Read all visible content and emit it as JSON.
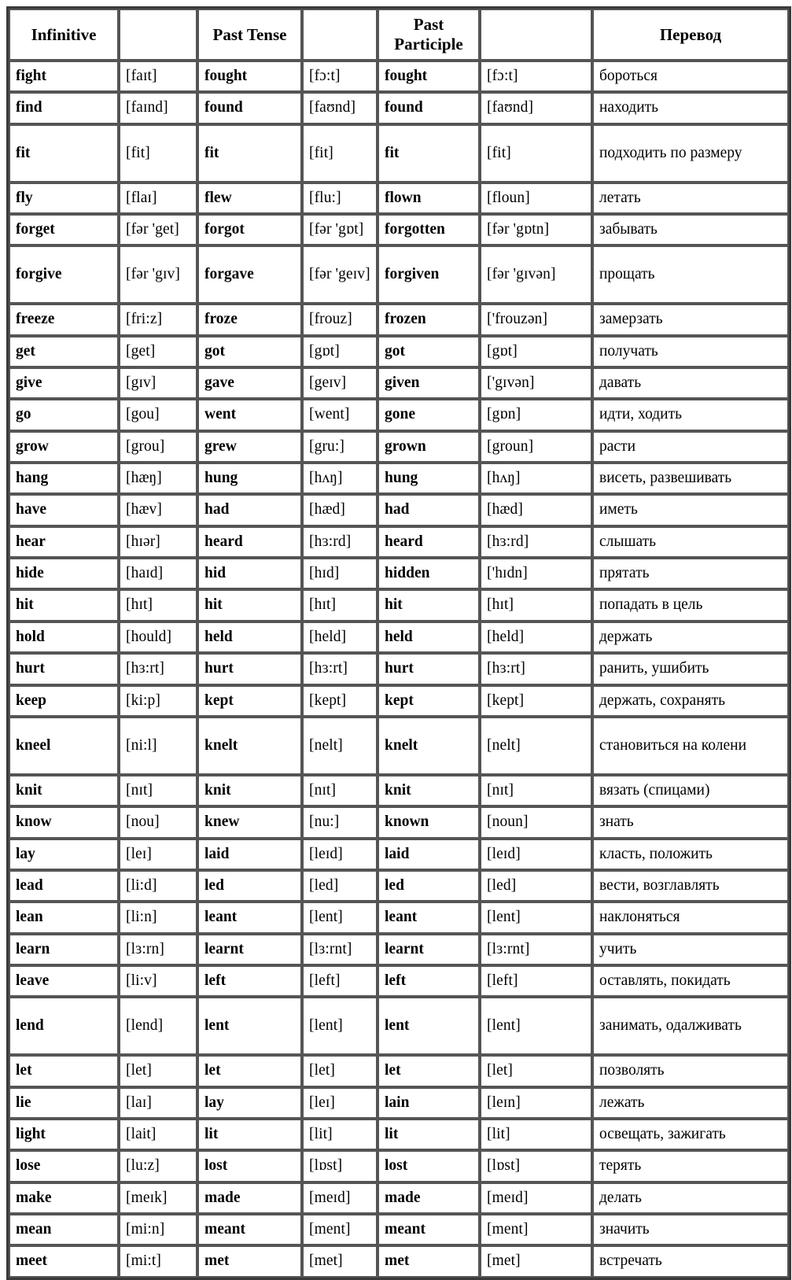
{
  "table": {
    "headers": {
      "infinitive": "Infinitive",
      "infinitive_ipa": "",
      "past_tense": "Past Tense",
      "past_tense_ipa": "",
      "past_participle": "Past\nParticiple",
      "past_participle_line1": "Past",
      "past_participle_line2": "Participle",
      "past_participle_ipa": "",
      "translation": "Перевод"
    },
    "rows": [
      {
        "infinitive": "fight",
        "inf_ipa": "[faɪt]",
        "past": "fought",
        "past_ipa": "[fɔ:t]",
        "pp": "fought",
        "pp_ipa": "[fɔ:t]",
        "ru": "бороться",
        "tall": false
      },
      {
        "infinitive": "find",
        "inf_ipa": "[faɪnd]",
        "past": "found",
        "past_ipa": "[faʊnd]",
        "pp": "found",
        "pp_ipa": "[faʊnd]",
        "ru": "находить",
        "tall": false
      },
      {
        "infinitive": "fit",
        "inf_ipa": "[fit]",
        "past": "fit",
        "past_ipa": "[fit]",
        "pp": "fit",
        "pp_ipa": "[fit]",
        "ru": "подходить по размеру",
        "tall": true
      },
      {
        "infinitive": "fly",
        "inf_ipa": "[flaɪ]",
        "past": "flew",
        "past_ipa": "[flu:]",
        "pp": "flown",
        "pp_ipa": "[floun]",
        "ru": "летать",
        "tall": false
      },
      {
        "infinitive": "forget",
        "inf_ipa": "[fər 'get]",
        "past": "forgot",
        "past_ipa": "[fər 'gɒt]",
        "pp": "forgotten",
        "pp_ipa": "[fər 'gɒtn]",
        "ru": "забывать",
        "tall": false
      },
      {
        "infinitive": "forgive",
        "inf_ipa": "[fər 'gɪv]",
        "past": "forgave",
        "past_ipa": "[fər 'geɪv]",
        "pp": "forgiven",
        "pp_ipa": "[fər 'gɪvən]",
        "ru": "прощать",
        "tall": true
      },
      {
        "infinitive": "freeze",
        "inf_ipa": "[fri:z]",
        "past": "froze",
        "past_ipa": "[frouz]",
        "pp": "frozen",
        "pp_ipa": "['frouzən]",
        "ru": "замерзать",
        "tall": false
      },
      {
        "infinitive": "get",
        "inf_ipa": "[get]",
        "past": "got",
        "past_ipa": "[gɒt]",
        "pp": "got",
        "pp_ipa": "[gɒt]",
        "ru": "получать",
        "tall": false
      },
      {
        "infinitive": "give",
        "inf_ipa": "[gɪv]",
        "past": "gave",
        "past_ipa": "[geɪv]",
        "pp": "given",
        "pp_ipa": "['gɪvən]",
        "ru": "давать",
        "tall": false
      },
      {
        "infinitive": "go",
        "inf_ipa": "[gou]",
        "past": "went",
        "past_ipa": "[went]",
        "pp": "gone",
        "pp_ipa": "[gɒn]",
        "ru": "идти, ходить",
        "tall": false
      },
      {
        "infinitive": "grow",
        "inf_ipa": "[grou]",
        "past": "grew",
        "past_ipa": "[gru:]",
        "pp": "grown",
        "pp_ipa": "[groun]",
        "ru": "расти",
        "tall": false
      },
      {
        "infinitive": "hang",
        "inf_ipa": "[hæŋ]",
        "past": "hung",
        "past_ipa": "[hʌŋ]",
        "pp": "hung",
        "pp_ipa": "[hʌŋ]",
        "ru": "висеть, развешивать",
        "tall": false
      },
      {
        "infinitive": "have",
        "inf_ipa": "[hæv]",
        "past": "had",
        "past_ipa": "[hæd]",
        "pp": "had",
        "pp_ipa": "[hæd]",
        "ru": "иметь",
        "tall": false
      },
      {
        "infinitive": "hear",
        "inf_ipa": "[hɪər]",
        "past": "heard",
        "past_ipa": "[hɜ:rd]",
        "pp": "heard",
        "pp_ipa": "[hɜ:rd]",
        "ru": "слышать",
        "tall": false
      },
      {
        "infinitive": "hide",
        "inf_ipa": "[haɪd]",
        "past": "hid",
        "past_ipa": "[hɪd]",
        "pp": "hidden",
        "pp_ipa": "['hɪdn]",
        "ru": "прятать",
        "tall": false
      },
      {
        "infinitive": "hit",
        "inf_ipa": "[hɪt]",
        "past": "hit",
        "past_ipa": "[hɪt]",
        "pp": "hit",
        "pp_ipa": "[hɪt]",
        "ru": "попадать в цель",
        "tall": false
      },
      {
        "infinitive": "hold",
        "inf_ipa": "[hould]",
        "past": "held",
        "past_ipa": "[held]",
        "pp": "held",
        "pp_ipa": "[held]",
        "ru": "держать",
        "tall": false
      },
      {
        "infinitive": "hurt",
        "inf_ipa": "[hɜ:rt]",
        "past": "hurt",
        "past_ipa": "[hɜ:rt]",
        "pp": "hurt",
        "pp_ipa": "[hɜ:rt]",
        "ru": "ранить, ушибить",
        "tall": false
      },
      {
        "infinitive": "keep",
        "inf_ipa": "[ki:p]",
        "past": "kept",
        "past_ipa": "[kept]",
        "pp": "kept",
        "pp_ipa": "[kept]",
        "ru": "держать, сохранять",
        "tall": false
      },
      {
        "infinitive": "kneel",
        "inf_ipa": "[ni:l]",
        "past": "knelt",
        "past_ipa": "[nelt]",
        "pp": "knelt",
        "pp_ipa": "[nelt]",
        "ru": "становиться на колени",
        "tall": true
      },
      {
        "infinitive": "knit",
        "inf_ipa": "[nɪt]",
        "past": "knit",
        "past_ipa": "[nɪt]",
        "pp": "knit",
        "pp_ipa": "[nɪt]",
        "ru": "вязать (спицами)",
        "tall": false
      },
      {
        "infinitive": "know",
        "inf_ipa": "[nou]",
        "past": "knew",
        "past_ipa": "[nu:]",
        "pp": "known",
        "pp_ipa": "[noun]",
        "ru": "знать",
        "tall": false
      },
      {
        "infinitive": "lay",
        "inf_ipa": "[leɪ]",
        "past": "laid",
        "past_ipa": "[leɪd]",
        "pp": "laid",
        "pp_ipa": "[leɪd]",
        "ru": "класть, положить",
        "tall": false
      },
      {
        "infinitive": "lead",
        "inf_ipa": "[li:d]",
        "past": "led",
        "past_ipa": "[led]",
        "pp": "led",
        "pp_ipa": "[led]",
        "ru": "вести, возглавлять",
        "tall": false
      },
      {
        "infinitive": "lean",
        "inf_ipa": "[li:n]",
        "past": "leant",
        "past_ipa": "[lent]",
        "pp": "leant",
        "pp_ipa": "[lent]",
        "ru": "наклоняться",
        "tall": false
      },
      {
        "infinitive": "learn",
        "inf_ipa": "[lɜ:rn]",
        "past": "learnt",
        "past_ipa": "[lɜ:rnt]",
        "pp": "learnt",
        "pp_ipa": "[lɜ:rnt]",
        "ru": "учить",
        "tall": false
      },
      {
        "infinitive": "leave",
        "inf_ipa": "[li:v]",
        "past": "left",
        "past_ipa": "[left]",
        "pp": "left",
        "pp_ipa": "[left]",
        "ru": "оставлять, покидать",
        "tall": false
      },
      {
        "infinitive": "lend",
        "inf_ipa": "[lend]",
        "past": "lent",
        "past_ipa": "[lent]",
        "pp": "lent",
        "pp_ipa": "[lent]",
        "ru": "занимать, одалживать",
        "tall": true
      },
      {
        "infinitive": "let",
        "inf_ipa": "[let]",
        "past": "let",
        "past_ipa": "[let]",
        "pp": "let",
        "pp_ipa": "[let]",
        "ru": "позволять",
        "tall": false
      },
      {
        "infinitive": "lie",
        "inf_ipa": "[laɪ]",
        "past": "lay",
        "past_ipa": "[leɪ]",
        "pp": "lain",
        "pp_ipa": "[leɪn]",
        "ru": "лежать",
        "tall": false
      },
      {
        "infinitive": "light",
        "inf_ipa": "[lait]",
        "past": "lit",
        "past_ipa": "[lit]",
        "pp": "lit",
        "pp_ipa": "[lit]",
        "ru": "освещать, зажигать",
        "tall": false
      },
      {
        "infinitive": "lose",
        "inf_ipa": "[lu:z]",
        "past": "lost",
        "past_ipa": "[lɒst]",
        "pp": "lost",
        "pp_ipa": "[lɒst]",
        "ru": "терять",
        "tall": false
      },
      {
        "infinitive": "make",
        "inf_ipa": "[meɪk]",
        "past": "made",
        "past_ipa": "[meɪd]",
        "pp": "made",
        "pp_ipa": "[meɪd]",
        "ru": "делать",
        "tall": false
      },
      {
        "infinitive": "mean",
        "inf_ipa": "[mi:n]",
        "past": "meant",
        "past_ipa": "[ment]",
        "pp": "meant",
        "pp_ipa": "[ment]",
        "ru": "значить",
        "tall": false
      },
      {
        "infinitive": "meet",
        "inf_ipa": "[mi:t]",
        "past": "met",
        "past_ipa": "[met]",
        "pp": "met",
        "pp_ipa": "[met]",
        "ru": "встречать",
        "tall": false
      }
    ]
  },
  "colors": {
    "outer_border": "#3a3a3a",
    "cell_border": "#555555",
    "background": "#ffffff",
    "text": "#000000"
  }
}
